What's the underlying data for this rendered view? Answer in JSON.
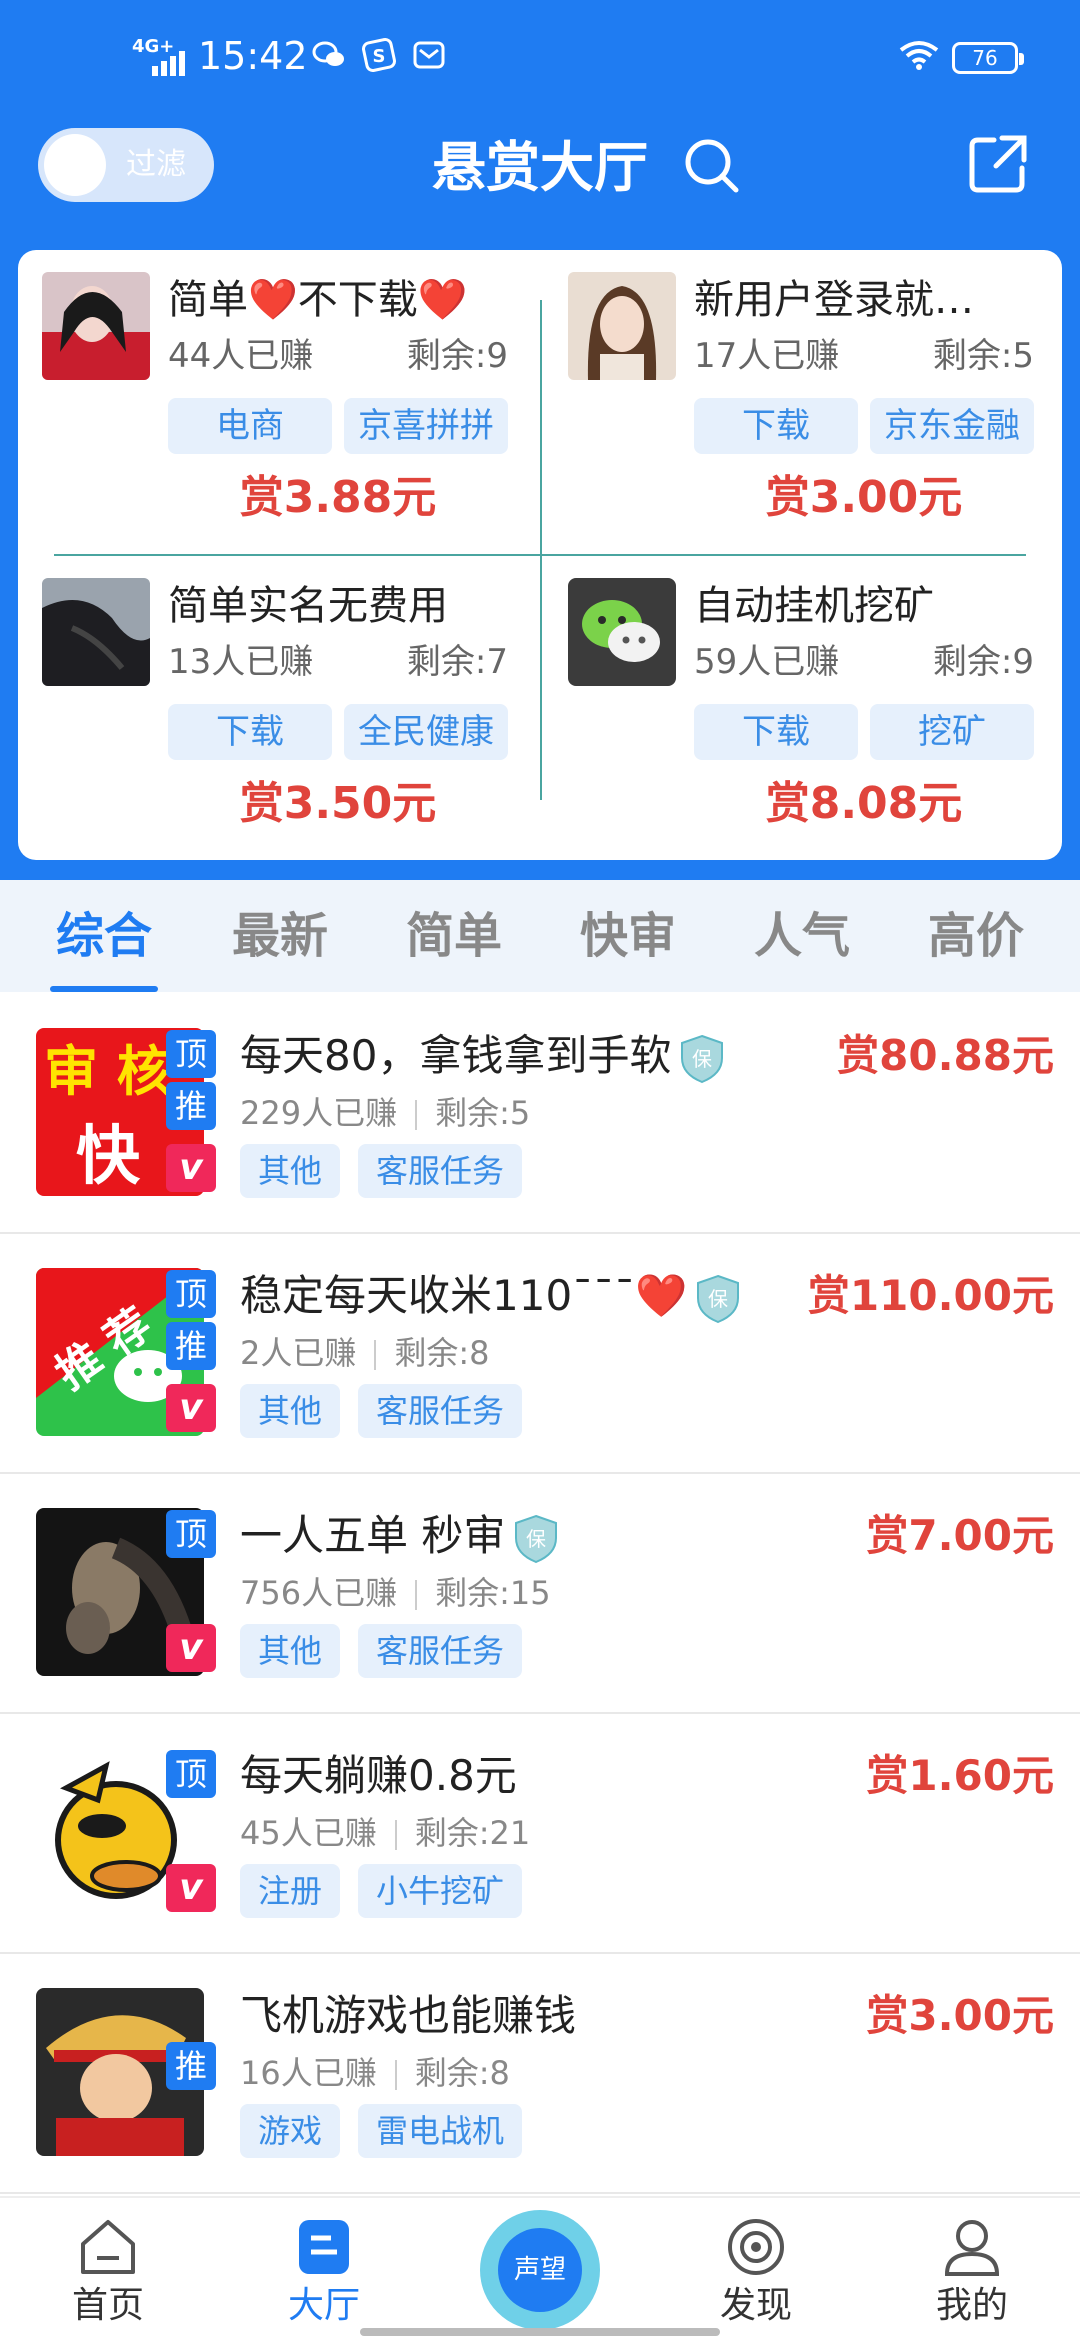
{
  "status_bar": {
    "network": "4G+",
    "time": "15:42",
    "battery": "76"
  },
  "header": {
    "filter_label": "过滤",
    "title": "悬赏大厅"
  },
  "featured": [
    {
      "title": "简单❤️不下载❤️",
      "earned": "44人已赚",
      "remain": "剩余:9",
      "tags": [
        "电商",
        "京喜拼拼"
      ],
      "reward": "赏3.88元"
    },
    {
      "title": "新用户登录就…",
      "earned": "17人已赚",
      "remain": "剩余:5",
      "tags": [
        "下载",
        "京东金融"
      ],
      "reward": "赏3.00元"
    },
    {
      "title": "简单实名无费用",
      "earned": "13人已赚",
      "remain": "剩余:7",
      "tags": [
        "下载",
        "全民健康"
      ],
      "reward": "赏3.50元"
    },
    {
      "title": "自动挂机挖矿",
      "earned": "59人已赚",
      "remain": "剩余:9",
      "tags": [
        "下载",
        "挖矿"
      ],
      "reward": "赏8.08元"
    }
  ],
  "tabs": [
    "综合",
    "最新",
    "简单",
    "快审",
    "人气",
    "高价"
  ],
  "tasks": [
    {
      "title": "每天80，拿钱拿到手软",
      "earned": "229人已赚",
      "remain": "剩余:5",
      "tags": [
        "其他",
        "客服任务"
      ],
      "reward": "赏80.88元",
      "badge_top": "顶",
      "badge_rec": "推",
      "badge_v": "v",
      "thumb_text_1": "审 核",
      "thumb_text_2": "快",
      "shield_text": "保"
    },
    {
      "title": "稳定每天收米110ˉˉˉ❤️",
      "earned": "2人已赚",
      "remain": "剩余:8",
      "tags": [
        "其他",
        "客服任务"
      ],
      "reward": "赏110.00元",
      "badge_top": "顶",
      "badge_rec": "推",
      "badge_v": "v",
      "thumb_text_1": "推 荐",
      "shield_text": "保"
    },
    {
      "title": "一人五单 秒审",
      "earned": "756人已赚",
      "remain": "剩余:15",
      "tags": [
        "其他",
        "客服任务"
      ],
      "reward": "赏7.00元",
      "badge_top": "顶",
      "badge_v": "v",
      "shield_text": "保"
    },
    {
      "title": "每天躺赚0.8元",
      "earned": "45人已赚",
      "remain": "剩余:21",
      "tags": [
        "注册",
        "小牛挖矿"
      ],
      "reward": "赏1.60元",
      "badge_top": "顶",
      "badge_v": "v"
    },
    {
      "title": "飞机游戏也能赚钱",
      "earned": "16人已赚",
      "remain": "剩余:8",
      "tags": [
        "游戏",
        "雷电战机"
      ],
      "reward": "赏3.00元",
      "badge_rec": "推"
    }
  ],
  "bottom_nav": {
    "home": "首页",
    "hall": "大厅",
    "center": "声望",
    "discover": "发现",
    "mine": "我的"
  },
  "colors": {
    "primary": "#1f7cf2",
    "reward": "#e0443c",
    "tag_bg": "#e6f0fc",
    "tag_text": "#3a8de6"
  }
}
